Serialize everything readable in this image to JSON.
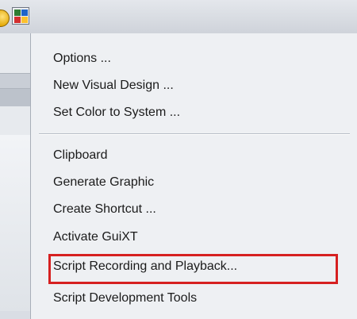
{
  "menu": {
    "items": [
      {
        "label": "Options ..."
      },
      {
        "label": "New Visual Design ..."
      },
      {
        "label": "Set Color to System ..."
      },
      {
        "label": "Clipboard"
      },
      {
        "label": "Generate Graphic"
      },
      {
        "label": "Create Shortcut ..."
      },
      {
        "label": "Activate GuiXT"
      },
      {
        "label": "Script Recording and Playback..."
      },
      {
        "label": "Script Development Tools"
      }
    ]
  },
  "colors": {
    "highlight_border": "#d62020",
    "menu_background": "#eef0f3"
  },
  "icons": {
    "toolbar_left": "yellow-circle-icon",
    "toolbar_layout": "customize-layout-icon"
  }
}
